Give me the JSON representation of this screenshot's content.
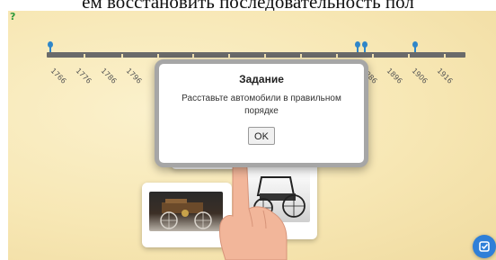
{
  "caption": "ем восстановить последовательность пол",
  "timeline": {
    "years": [
      "1766",
      "1776",
      "1786",
      "1796",
      "1886",
      "1896",
      "1906",
      "1916"
    ]
  },
  "dialog": {
    "title": "Задание",
    "text": "Расставьте автомобили в правильном порядке",
    "ok_label": "OK"
  },
  "icons": {
    "help": "help-icon",
    "marker": "timeline-marker-icon",
    "hand": "pointing-hand-icon",
    "fab": "check-icon"
  },
  "colors": {
    "background": "#f7e7b4",
    "timeline": "#6a6a6a",
    "marker": "#2f86c9",
    "dialog_border": "#a6a6a6",
    "fab": "#2f7fd8"
  }
}
